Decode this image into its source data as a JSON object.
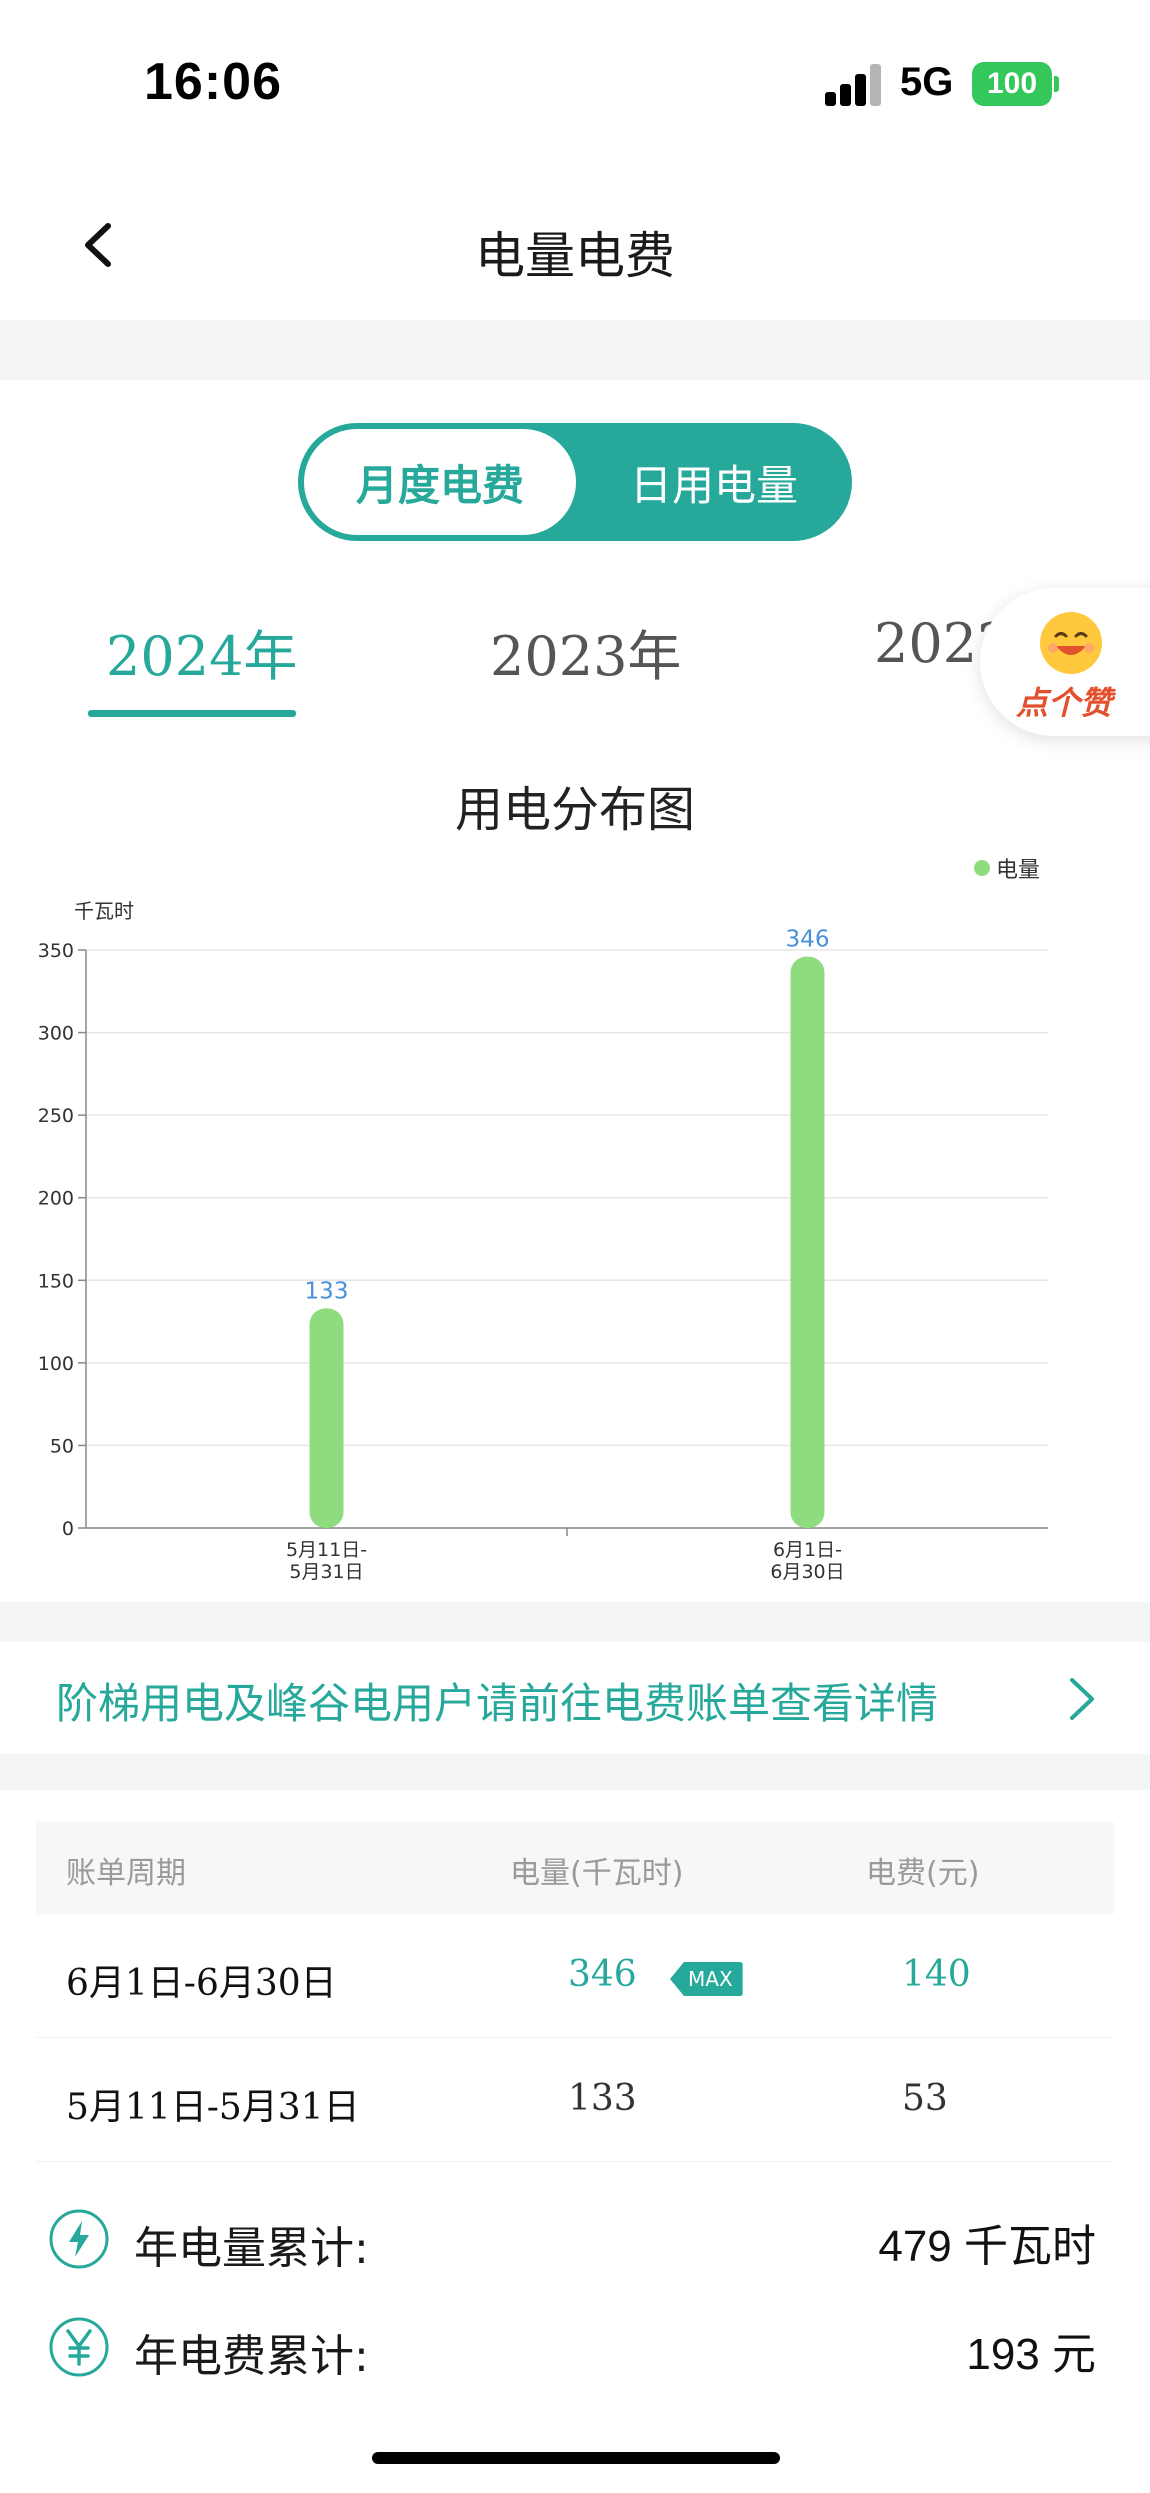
{
  "status_bar": {
    "time": "16:06",
    "network": "5G",
    "battery": "100"
  },
  "nav": {
    "title": "电量电费"
  },
  "segmented": {
    "options": [
      "月度电费",
      "日用电量"
    ],
    "selected": "月度电费"
  },
  "year_tabs": {
    "items": [
      "2024年",
      "2023年",
      "2022"
    ],
    "selected": "2024年"
  },
  "like_badge": {
    "label": "点个赞"
  },
  "chart_data": {
    "type": "bar",
    "title": "用电分布图",
    "ylabel": "千瓦时",
    "categories": [
      "5月11日-\n5月31日",
      "6月1日-\n6月30日"
    ],
    "series": [
      {
        "name": "电量",
        "values": [
          133,
          346
        ],
        "color": "#8fdc7e"
      }
    ],
    "ylim": [
      0,
      350
    ],
    "yticks": [
      0,
      50,
      100,
      150,
      200,
      250,
      300,
      350
    ],
    "data_labels": true,
    "grid": true,
    "legend": "top-right"
  },
  "notice": {
    "text": "阶梯用电及峰谷电用户请前往电费账单查看详情"
  },
  "table": {
    "headers": [
      "账单周期",
      "电量(千瓦时)",
      "电费(元)"
    ],
    "rows": [
      {
        "period": "6月1日-6月30日",
        "kwh": "346",
        "fee": "140",
        "badge": "MAX",
        "highlight": true
      },
      {
        "period": "5月11日-5月31日",
        "kwh": "133",
        "fee": "53",
        "badge": "",
        "highlight": false
      }
    ]
  },
  "summary": {
    "annual_kwh": {
      "label": "年电量累计:",
      "value": "479 千瓦时"
    },
    "annual_fee": {
      "label": "年电费累计:",
      "value": "193 元"
    }
  },
  "colors": {
    "accent": "#26a89a",
    "bar": "#8fdc7e",
    "data_label": "#4a90d9"
  }
}
